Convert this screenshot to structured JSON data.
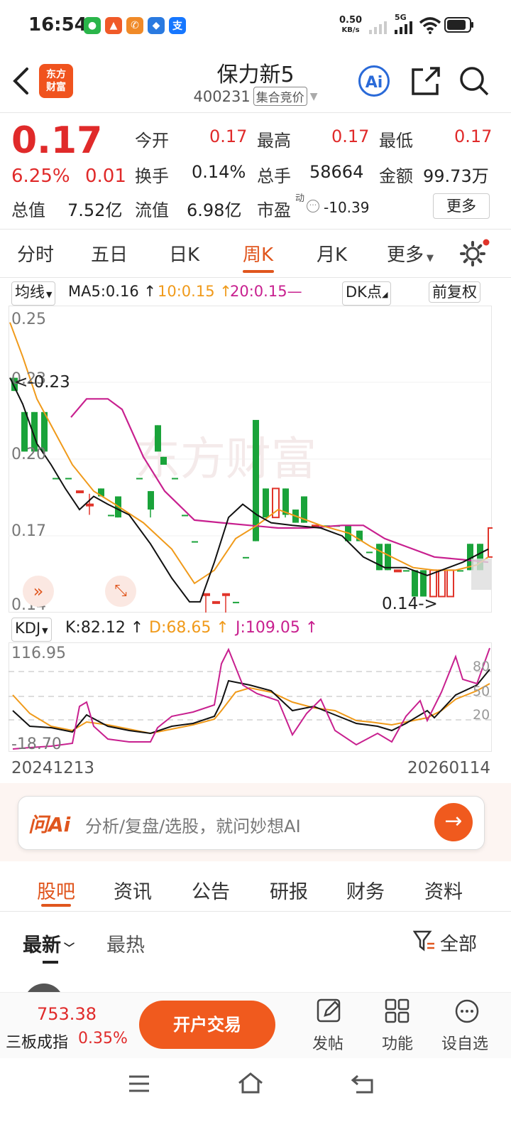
{
  "status_bar": {
    "time": "16:54",
    "speed_value": "0.50",
    "speed_unit": "KB/s",
    "network": "5G"
  },
  "header": {
    "logo_line1": "东方",
    "logo_line2": "财富",
    "title": "保力新5",
    "code": "400231",
    "tag": "集合竞价",
    "ai_label": "Ai"
  },
  "quote": {
    "price": "0.17",
    "change_pct": "6.25%",
    "change": "0.01",
    "open_label": "今开",
    "open": "0.17",
    "high_label": "最高",
    "high": "0.17",
    "low_label": "最低",
    "low": "0.17",
    "turnover_label": "换手",
    "turnover": "0.14%",
    "volume_label": "总手",
    "volume": "58664",
    "amount_label": "金额",
    "amount": "99.73万",
    "mcap_label": "总值",
    "mcap": "7.52亿",
    "float_label": "流值",
    "float": "6.98亿",
    "pe_label": "市盈",
    "pe_sup": "动",
    "pe": "-10.39",
    "more": "更多"
  },
  "chart_tabs": [
    "分时",
    "五日",
    "日K",
    "周K",
    "月K",
    "更多"
  ],
  "chart_header": {
    "ma_chip": "均线",
    "ma5": "MA5:0.16",
    "ma10": "10:0.15",
    "ma20": "20:0.15",
    "dk": "DK点",
    "adjust": "前复权",
    "watermark": "东方财富"
  },
  "kline_axis": {
    "y_ticks": [
      "0.25",
      "0.23",
      "0.20",
      "0.17",
      "0.14"
    ],
    "high_mark": "0.23",
    "low_mark": "0.14"
  },
  "kdj_header": {
    "chip": "KDJ",
    "k": "K:82.12",
    "d": "D:68.65",
    "j": "J:109.05"
  },
  "kdj_axis": {
    "top": "116.95",
    "bottom": "-18.70",
    "levels": [
      "80",
      "50",
      "20"
    ]
  },
  "dates": {
    "start": "20241213",
    "end": "20260114"
  },
  "ai_bar": {
    "logo": "问Ai",
    "placeholder": "分析/复盘/选股，就问妙想AI"
  },
  "bottom_tabs": [
    "股吧",
    "资讯",
    "公告",
    "研报",
    "财务",
    "资料"
  ],
  "sort": {
    "latest": "最新",
    "hot": "最热",
    "filter": "全部"
  },
  "toolbar": {
    "index_value": "753.38",
    "index_name": "三板成指",
    "index_change": "0.35%",
    "trade_button": "开户交易",
    "post": "发帖",
    "function": "功能",
    "add_watch": "设自选"
  },
  "chart_data": {
    "type": "candlestick",
    "ylim": [
      0.14,
      0.25
    ],
    "candles_close_direction": [
      "down",
      "down",
      "down",
      "down",
      "down",
      "down",
      "up",
      "up",
      "down",
      "down",
      "down",
      "down",
      "down",
      "down",
      "down",
      "down",
      "down",
      "down",
      "up",
      "up",
      "up",
      "down",
      "down",
      "down",
      "down",
      "up",
      "down",
      "down",
      "down",
      "up",
      "down",
      "down",
      "down",
      "down",
      "down",
      "down",
      "down",
      "up",
      "down",
      "down",
      "down",
      "up",
      "up",
      "up",
      "down",
      "down",
      "down",
      "up"
    ],
    "ma5": 0.16,
    "ma10": 0.15,
    "ma20": 0.15,
    "kdj": {
      "K": 82.12,
      "D": 68.65,
      "J": 109.05,
      "ylim": [
        -18.7,
        116.95
      ]
    }
  }
}
